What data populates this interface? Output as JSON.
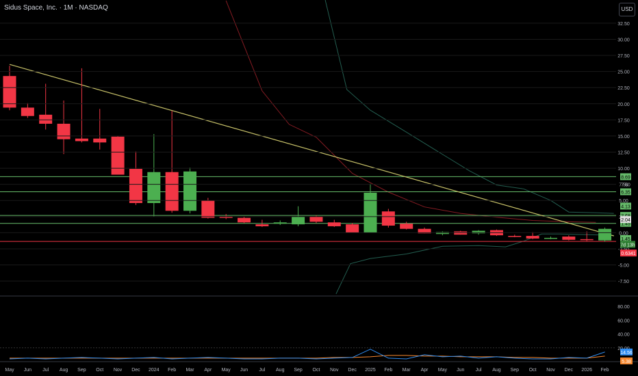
{
  "header": {
    "title": "Sidus Space, Inc. · 1M · NASDAQ",
    "currency": "USD"
  },
  "chart_data": {
    "type": "candlestick",
    "x_labels": [
      "May",
      "Jun",
      "Jul",
      "Aug",
      "Sep",
      "Oct",
      "Nov",
      "Dec",
      "2024",
      "Feb",
      "Mar",
      "Apr",
      "May",
      "Jun",
      "Jul",
      "Aug",
      "Sep",
      "Oct",
      "Nov",
      "Dec",
      "2025",
      "Feb",
      "Mar",
      "Apr",
      "May",
      "Jun",
      "Jul",
      "Aug",
      "Sep",
      "Oct",
      "Nov",
      "Dec",
      "2026",
      "Feb"
    ],
    "y_ticks": [
      "32.50",
      "30.00",
      "27.50",
      "25.00",
      "22.50",
      "20.00",
      "17.50",
      "15.00",
      "12.50",
      "10.00",
      "7.50",
      "5.00",
      "2.50",
      "0.00",
      "-2.50",
      "-5.00",
      "-7.50"
    ],
    "ylim": [
      -9.5,
      34.5
    ],
    "candles": [
      {
        "o": 24.3,
        "h": 25.9,
        "l": 19.0,
        "c": 19.4
      },
      {
        "o": 19.4,
        "h": 20.1,
        "l": 17.8,
        "c": 18.1
      },
      {
        "o": 18.3,
        "h": 23.1,
        "l": 16.0,
        "c": 16.9
      },
      {
        "o": 16.9,
        "h": 20.5,
        "l": 12.2,
        "c": 14.5
      },
      {
        "o": 14.6,
        "h": 25.5,
        "l": 14.0,
        "c": 14.2
      },
      {
        "o": 14.6,
        "h": 19.2,
        "l": 12.9,
        "c": 14.0
      },
      {
        "o": 14.9,
        "h": 15.0,
        "l": 9.0,
        "c": 9.0
      },
      {
        "o": 9.9,
        "h": 12.6,
        "l": 4.3,
        "c": 4.6
      },
      {
        "o": 4.6,
        "h": 15.3,
        "l": 2.5,
        "c": 9.4
      },
      {
        "o": 9.4,
        "h": 18.9,
        "l": 3.1,
        "c": 3.4
      },
      {
        "o": 3.4,
        "h": 10.1,
        "l": 3.0,
        "c": 9.5
      },
      {
        "o": 5.0,
        "h": 5.4,
        "l": 2.2,
        "c": 2.3
      },
      {
        "o": 2.5,
        "h": 2.9,
        "l": 2.1,
        "c": 2.3
      },
      {
        "o": 2.3,
        "h": 2.5,
        "l": 1.5,
        "c": 1.6
      },
      {
        "o": 1.3,
        "h": 2.0,
        "l": 0.9,
        "c": 1.0
      },
      {
        "o": 1.4,
        "h": 1.9,
        "l": 1.2,
        "c": 1.6
      },
      {
        "o": 1.3,
        "h": 4.1,
        "l": 1.0,
        "c": 2.5
      },
      {
        "o": 2.5,
        "h": 2.7,
        "l": 1.5,
        "c": 1.7
      },
      {
        "o": 1.6,
        "h": 2.0,
        "l": 0.9,
        "c": 1.0
      },
      {
        "o": 1.3,
        "h": 1.5,
        "l": 0.0,
        "c": 0.0
      },
      {
        "o": 0.0,
        "h": 7.6,
        "l": 0.3,
        "c": 6.2
      },
      {
        "o": 3.3,
        "h": 3.7,
        "l": 0.8,
        "c": 1.1
      },
      {
        "o": 1.4,
        "h": 1.7,
        "l": 0.5,
        "c": 0.6
      },
      {
        "o": 0.6,
        "h": 0.8,
        "l": -0.1,
        "c": -0.1
      },
      {
        "o": -0.2,
        "h": 0.2,
        "l": -0.4,
        "c": 0.1
      },
      {
        "o": 0.2,
        "h": 0.3,
        "l": -0.3,
        "c": -0.3
      },
      {
        "o": -0.1,
        "h": 0.4,
        "l": -0.3,
        "c": 0.3
      },
      {
        "o": 0.4,
        "h": 0.5,
        "l": -0.5,
        "c": -0.4
      },
      {
        "o": -0.5,
        "h": -0.3,
        "l": -0.7,
        "c": -0.6
      },
      {
        "o": -0.5,
        "h": 0.1,
        "l": -1.0,
        "c": -0.9
      },
      {
        "o": -0.9,
        "h": -0.6,
        "l": -1.0,
        "c": -0.8
      },
      {
        "o": -0.6,
        "h": -0.4,
        "l": -1.2,
        "c": -1.1
      },
      {
        "o": -1.0,
        "h": 0.2,
        "l": -1.3,
        "c": -1.1
      },
      {
        "o": -1.2,
        "h": 0.8,
        "l": -1.4,
        "c": 0.6
      }
    ],
    "trendline": {
      "from": [
        0,
        26.1
      ],
      "to": [
        33.5,
        -0.5
      ]
    },
    "price_levels": [
      {
        "value": 8.69,
        "label": "8.69"
      },
      {
        "value": 6.35,
        "label": "6.35"
      },
      {
        "value": 2.68,
        "label": "2.68"
      },
      {
        "value": 1.45,
        "label": "1.45"
      }
    ],
    "axis_labels": [
      {
        "value": 7.5,
        "label": "7.50",
        "style": "plain"
      },
      {
        "value": 4.13,
        "label": "4.13",
        "style": "green"
      },
      {
        "value": 2.04,
        "label": "2.04",
        "style": "white"
      },
      {
        "value": -0.9,
        "label": "1.45",
        "style": "green"
      },
      {
        "value": -1.8,
        "label": "7d 13h",
        "style": "green-small"
      },
      {
        "value": -3.15,
        "label": "0.6341",
        "style": "red"
      }
    ],
    "red_line": -1.35,
    "bands": {
      "upper_red": [
        [
          12,
          36
        ],
        [
          14,
          22
        ],
        [
          15.5,
          16.8
        ],
        [
          17,
          14.8
        ],
        [
          19,
          9.2
        ],
        [
          21,
          6.3
        ],
        [
          23,
          4.0
        ],
        [
          25,
          3.0
        ],
        [
          27,
          2.4
        ],
        [
          29,
          1.9
        ],
        [
          31,
          1.7
        ],
        [
          32.5,
          1.6
        ]
      ],
      "upper_green": [
        [
          17.5,
          37
        ],
        [
          18.7,
          22.2
        ],
        [
          20,
          19.0
        ],
        [
          22,
          15.6
        ],
        [
          23.8,
          12.5
        ],
        [
          25.5,
          9.6
        ],
        [
          27,
          7.4
        ],
        [
          28.5,
          6.8
        ],
        [
          30,
          5.0
        ],
        [
          31,
          3.2
        ],
        [
          32.5,
          3.1
        ],
        [
          33.5,
          3.0
        ]
      ],
      "lower_green": [
        [
          18.1,
          -9.5
        ],
        [
          18.9,
          -4.8
        ],
        [
          20,
          -4.0
        ],
        [
          22,
          -3.3
        ],
        [
          24,
          -2.1
        ],
        [
          26,
          -2.0
        ],
        [
          27.5,
          -2.2
        ],
        [
          28.5,
          -1.3
        ],
        [
          29.5,
          -0.2
        ],
        [
          30.5,
          -0.2
        ],
        [
          32,
          -0.3
        ],
        [
          33.5,
          -0.4
        ]
      ]
    },
    "oscillator": {
      "ticks": [
        "80.00",
        "60.00",
        "40.00",
        "20.00"
      ],
      "ylim": [
        0,
        95
      ],
      "blue_values": [
        4,
        5,
        4,
        5,
        6,
        5,
        4,
        5,
        6,
        4,
        5,
        6,
        5,
        4,
        4,
        5,
        5,
        4,
        5,
        6,
        18,
        5,
        4,
        10,
        7,
        8,
        5,
        7,
        5,
        4,
        4,
        6,
        5,
        14
      ],
      "orange_values": [
        5,
        5,
        5,
        5,
        5,
        5,
        5,
        5,
        5,
        5,
        5,
        5,
        5,
        5,
        5,
        5,
        5,
        5,
        6,
        6,
        7,
        9,
        9,
        8,
        8,
        7,
        7,
        7,
        6,
        6,
        5,
        5,
        5,
        8
      ],
      "blue_label": "14.56",
      "orange_label": "5.38"
    },
    "colors": {
      "up": "#4caf50",
      "down": "#f23645",
      "trend": "#c9c36a",
      "level": "#66bb6a",
      "red_line": "#f23645",
      "blue": "#2f8cf0",
      "orange": "#f7882f",
      "grid": "#1a1a1a",
      "text": "#b2b5be",
      "osc_border": "#363a45"
    }
  }
}
